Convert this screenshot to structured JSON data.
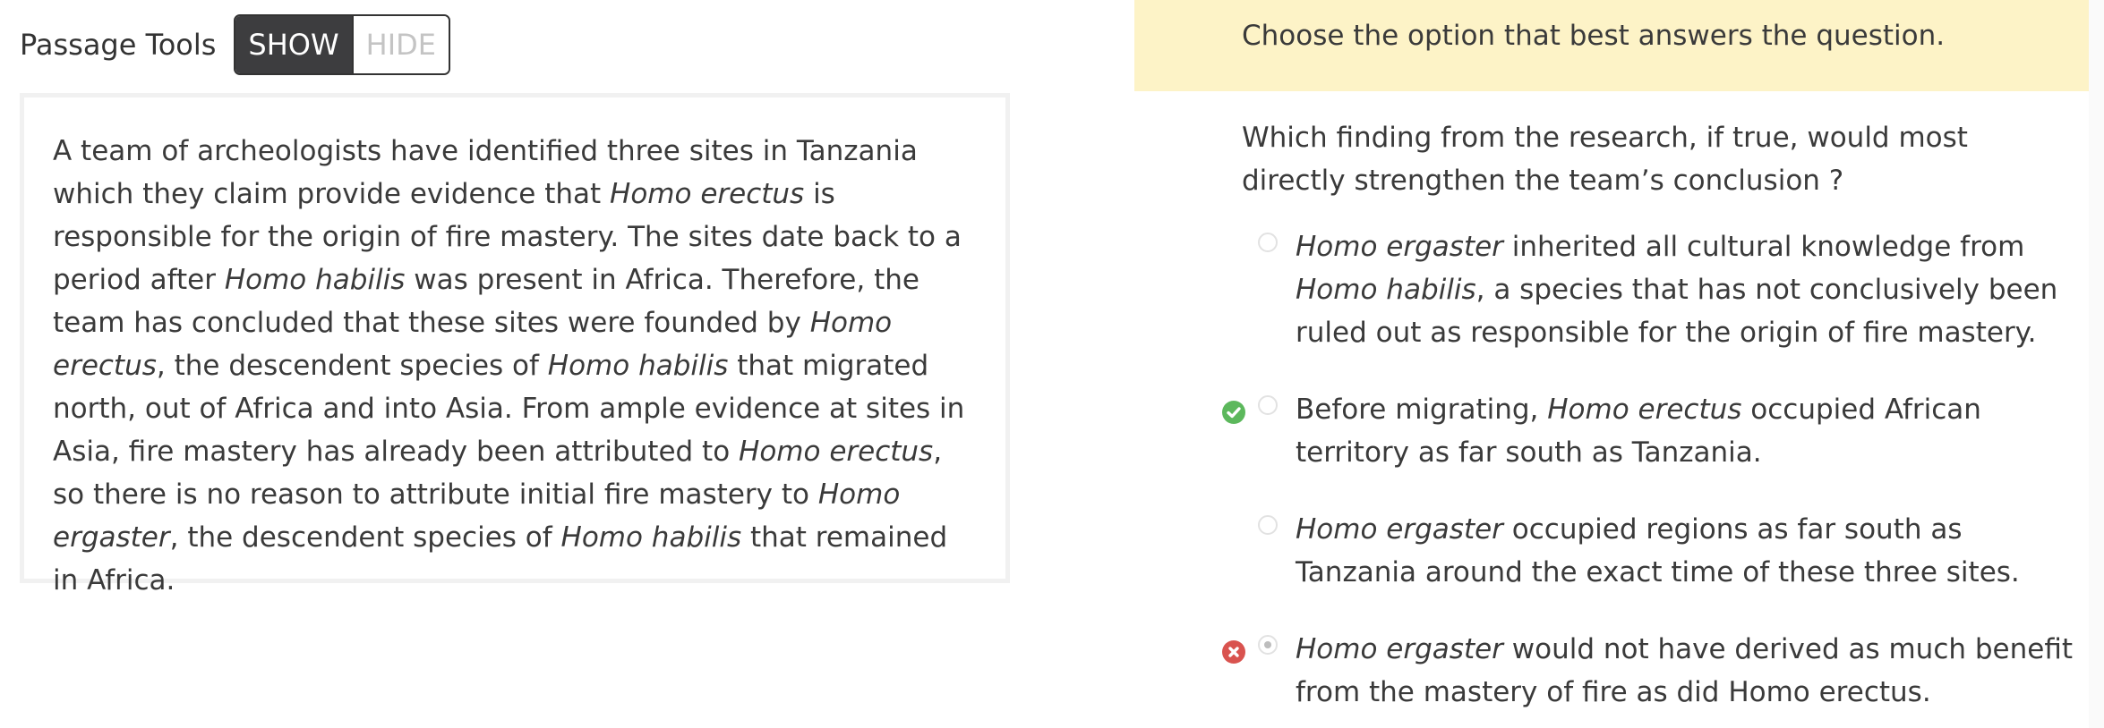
{
  "passage_tools": {
    "label": "Passage Tools",
    "show": "SHOW",
    "hide": "HIDE"
  },
  "passage": [
    {
      "t": "A team of archeologists have identified three sites in Tanzania which they claim provide evidence that ",
      "i": false
    },
    {
      "t": "Homo erectus",
      "i": true
    },
    {
      "t": " is responsible for the origin of fire mastery. The sites date back to a period after ",
      "i": false
    },
    {
      "t": "Homo habilis",
      "i": true
    },
    {
      "t": " was present in Africa. Therefore, the team has concluded that these sites were founded by ",
      "i": false
    },
    {
      "t": "Homo erectus",
      "i": true
    },
    {
      "t": ", the descendent species of ",
      "i": false
    },
    {
      "t": "Homo habilis",
      "i": true
    },
    {
      "t": " that migrated north, out of Africa and into Asia. From ample evidence at sites in Asia, fire mastery has already been attributed to ",
      "i": false
    },
    {
      "t": "Homo erectus",
      "i": true
    },
    {
      "t": ", so there is no reason to attribute initial fire mastery to ",
      "i": false
    },
    {
      "t": "Homo ergaster",
      "i": true
    },
    {
      "t": ", the descendent species of ",
      "i": false
    },
    {
      "t": "Homo habilis",
      "i": true
    },
    {
      "t": " that remained in Africa.",
      "i": false
    }
  ],
  "instruction": "Choose the option that best answers the question.",
  "question": "Which finding from the research, if true, would most directly strengthen the team’s conclusion ?",
  "options": [
    {
      "status": "none",
      "selected": false,
      "parts": [
        {
          "t": "Homo ergaster",
          "i": true
        },
        {
          "t": " inherited all cultural knowledge from ",
          "i": false
        },
        {
          "t": "Homo habilis",
          "i": true
        },
        {
          "t": ", a species that has not conclusively been ruled out as responsible for the origin of fire mastery.",
          "i": false
        }
      ]
    },
    {
      "status": "correct",
      "selected": false,
      "parts": [
        {
          "t": "Before migrating, ",
          "i": false
        },
        {
          "t": "Homo erectus",
          "i": true
        },
        {
          "t": " occupied African territory as far south as Tanzania.",
          "i": false
        }
      ]
    },
    {
      "status": "none",
      "selected": false,
      "parts": [
        {
          "t": "Homo ergaster",
          "i": true
        },
        {
          "t": " occupied regions as far south as Tanzania around the exact time of these three sites.",
          "i": false
        }
      ]
    },
    {
      "status": "incorrect",
      "selected": true,
      "parts": [
        {
          "t": "Homo ergaster",
          "i": true
        },
        {
          "t": " would not have derived as much benefit from the mastery of fire as did Homo erectus.",
          "i": false
        }
      ]
    }
  ],
  "colors": {
    "banner": "#fdf3c7",
    "correct": "#5cb85c",
    "incorrect": "#d9534f",
    "toggle_active": "#3d3d3f"
  }
}
